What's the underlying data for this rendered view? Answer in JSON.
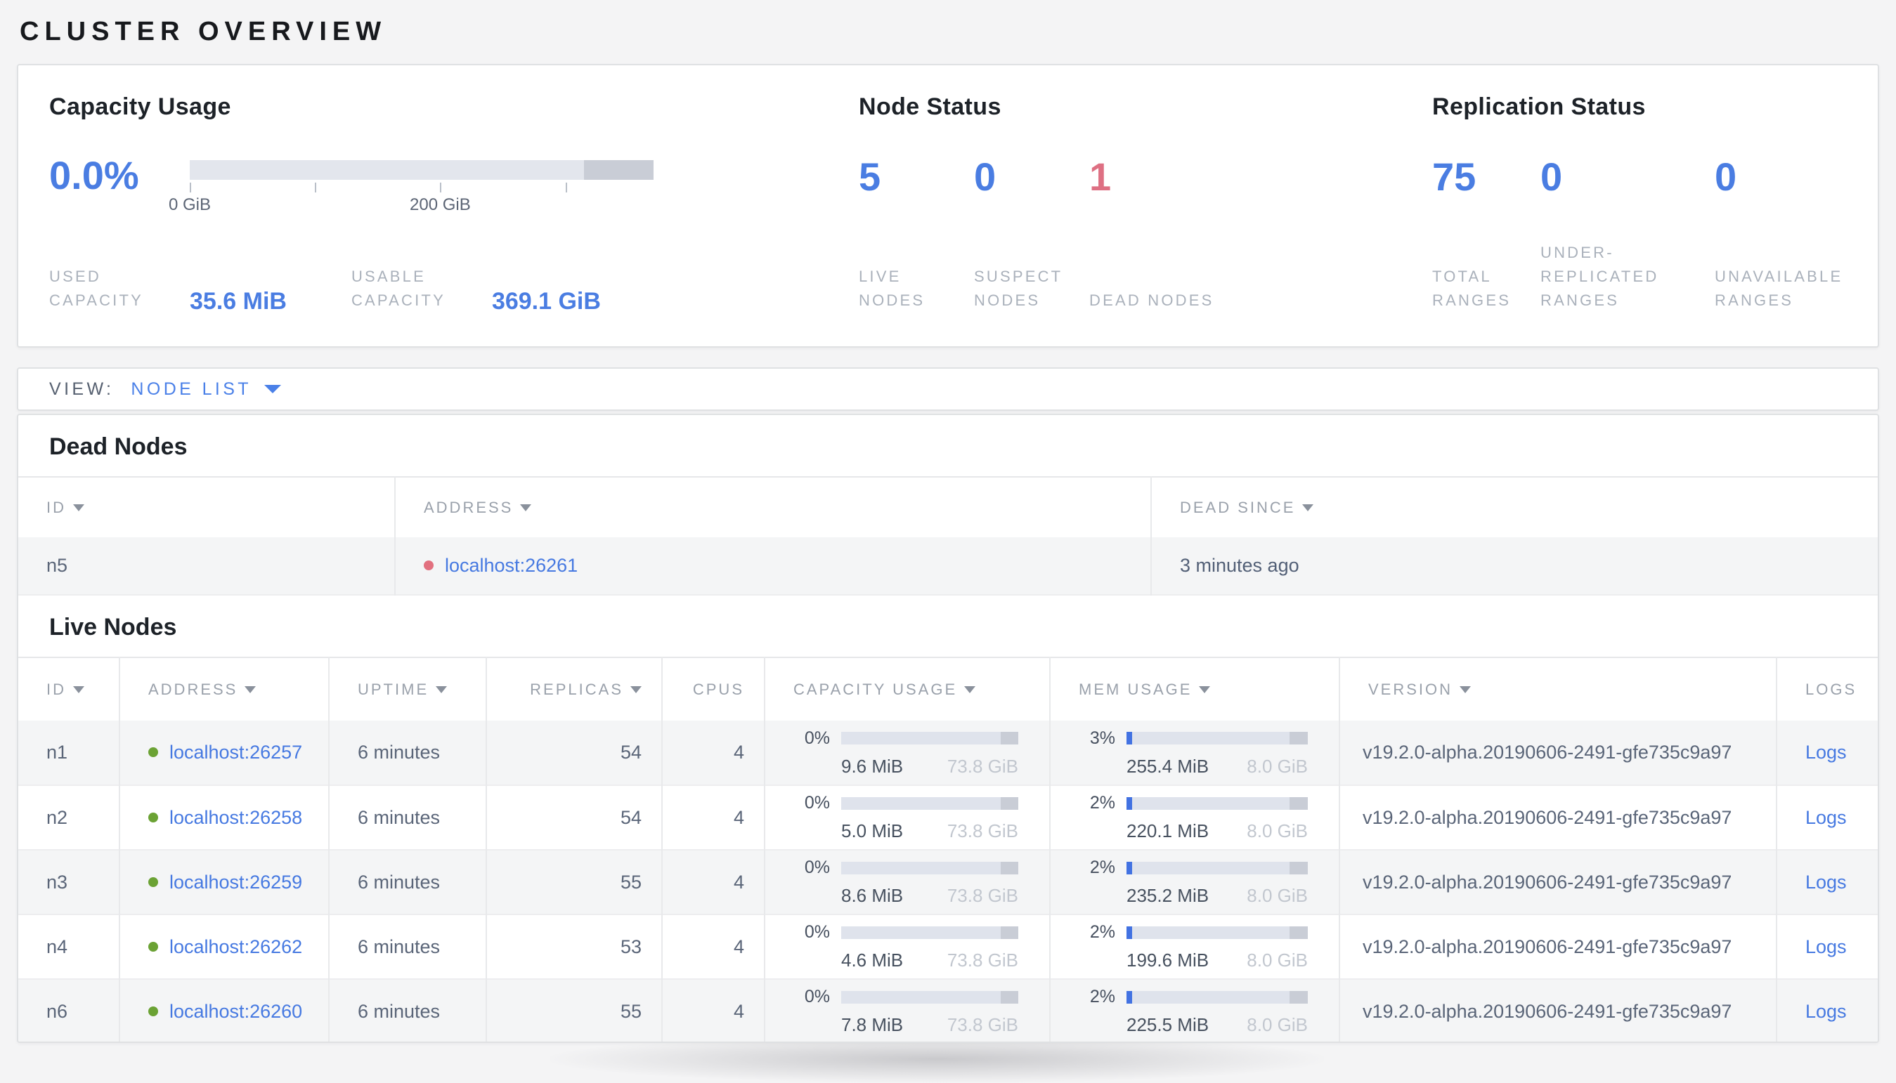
{
  "page": {
    "title": "CLUSTER OVERVIEW"
  },
  "colors": {
    "accent_blue": "#4a7de2",
    "danger_red": "#de7083",
    "link_blue": "#4679e1",
    "live_green": "#6ba234",
    "dead_red": "#e2707f"
  },
  "summary": {
    "capacity": {
      "heading": "Capacity Usage",
      "percent_label": "0.0%",
      "gauge": {
        "fill_percent": 0,
        "other_percent": 15,
        "ticks": [
          {
            "pos_percent": 0,
            "label": "0 GiB"
          },
          {
            "pos_percent": 27,
            "label": ""
          },
          {
            "pos_percent": 54,
            "label": "200 GiB"
          },
          {
            "pos_percent": 81,
            "label": ""
          }
        ]
      },
      "stats": [
        {
          "label": "USED CAPACITY",
          "value": "35.6 MiB"
        },
        {
          "label": "USABLE CAPACITY",
          "value": "369.1 GiB"
        }
      ]
    },
    "node_status": {
      "heading": "Node Status",
      "stats": [
        {
          "value": "5",
          "label": "LIVE NODES",
          "color": "#4a7de2"
        },
        {
          "value": "0",
          "label": "SUSPECT NODES",
          "color": "#4a7de2"
        },
        {
          "value": "1",
          "label": "DEAD NODES",
          "color": "#de7083"
        }
      ]
    },
    "replication": {
      "heading": "Replication Status",
      "stats": [
        {
          "value": "75",
          "label": "TOTAL RANGES",
          "color": "#4a7de2"
        },
        {
          "value": "0",
          "label": "UNDER-REPLICATED RANGES",
          "color": "#4a7de2"
        },
        {
          "value": "0",
          "label": "UNAVAILABLE RANGES",
          "color": "#4a7de2"
        }
      ]
    }
  },
  "view_bar": {
    "label": "VIEW:",
    "selected": "NODE LIST"
  },
  "dead_nodes": {
    "heading": "Dead Nodes",
    "columns": [
      {
        "label": "ID",
        "sortable": true
      },
      {
        "label": "ADDRESS",
        "sortable": true
      },
      {
        "label": "DEAD SINCE",
        "sortable": true
      }
    ],
    "rows": [
      {
        "id": "n5",
        "address": "localhost:26261",
        "dead_since": "3 minutes ago"
      }
    ]
  },
  "live_nodes": {
    "heading": "Live Nodes",
    "columns": [
      {
        "label": "ID",
        "sortable": true
      },
      {
        "label": "ADDRESS",
        "sortable": true
      },
      {
        "label": "UPTIME",
        "sortable": true
      },
      {
        "label": "REPLICAS",
        "sortable": true
      },
      {
        "label": "CPUS",
        "sortable": false
      },
      {
        "label": "CAPACITY USAGE",
        "sortable": true
      },
      {
        "label": "MEM USAGE",
        "sortable": true
      },
      {
        "label": "VERSION",
        "sortable": true
      },
      {
        "label": "LOGS",
        "sortable": false
      }
    ],
    "rows": [
      {
        "id": "n1",
        "address": "localhost:26257",
        "uptime": "6 minutes",
        "replicas": "54",
        "cpus": "4",
        "capacity": {
          "percent": "0%",
          "fill": 0,
          "other": 10,
          "used": "9.6 MiB",
          "total": "73.8 GiB"
        },
        "mem": {
          "percent": "3%",
          "fill": 3,
          "other": 10,
          "used": "255.4 MiB",
          "total": "8.0 GiB"
        },
        "version": "v19.2.0-alpha.20190606-2491-gfe735c9a97",
        "logs": "Logs"
      },
      {
        "id": "n2",
        "address": "localhost:26258",
        "uptime": "6 minutes",
        "replicas": "54",
        "cpus": "4",
        "capacity": {
          "percent": "0%",
          "fill": 0,
          "other": 10,
          "used": "5.0 MiB",
          "total": "73.8 GiB"
        },
        "mem": {
          "percent": "2%",
          "fill": 2,
          "other": 10,
          "used": "220.1 MiB",
          "total": "8.0 GiB"
        },
        "version": "v19.2.0-alpha.20190606-2491-gfe735c9a97",
        "logs": "Logs"
      },
      {
        "id": "n3",
        "address": "localhost:26259",
        "uptime": "6 minutes",
        "replicas": "55",
        "cpus": "4",
        "capacity": {
          "percent": "0%",
          "fill": 0,
          "other": 10,
          "used": "8.6 MiB",
          "total": "73.8 GiB"
        },
        "mem": {
          "percent": "2%",
          "fill": 2,
          "other": 10,
          "used": "235.2 MiB",
          "total": "8.0 GiB"
        },
        "version": "v19.2.0-alpha.20190606-2491-gfe735c9a97",
        "logs": "Logs"
      },
      {
        "id": "n4",
        "address": "localhost:26262",
        "uptime": "6 minutes",
        "replicas": "53",
        "cpus": "4",
        "capacity": {
          "percent": "0%",
          "fill": 0,
          "other": 10,
          "used": "4.6 MiB",
          "total": "73.8 GiB"
        },
        "mem": {
          "percent": "2%",
          "fill": 2,
          "other": 10,
          "used": "199.6 MiB",
          "total": "8.0 GiB"
        },
        "version": "v19.2.0-alpha.20190606-2491-gfe735c9a97",
        "logs": "Logs"
      },
      {
        "id": "n6",
        "address": "localhost:26260",
        "uptime": "6 minutes",
        "replicas": "55",
        "cpus": "4",
        "capacity": {
          "percent": "0%",
          "fill": 0,
          "other": 10,
          "used": "7.8 MiB",
          "total": "73.8 GiB"
        },
        "mem": {
          "percent": "2%",
          "fill": 2,
          "other": 10,
          "used": "225.5 MiB",
          "total": "8.0 GiB"
        },
        "version": "v19.2.0-alpha.20190606-2491-gfe735c9a97",
        "logs": "Logs"
      }
    ]
  }
}
